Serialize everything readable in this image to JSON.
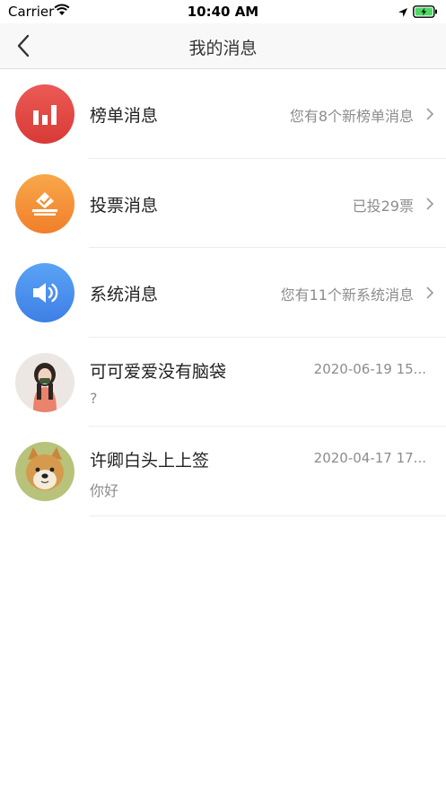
{
  "status": {
    "carrier": "Carrier",
    "time": "10:40 AM"
  },
  "nav": {
    "title": "我的消息"
  },
  "system_items": [
    {
      "title": "榜单消息",
      "detail": "您有8个新榜单消息",
      "icon": "bar-chart-icon",
      "color": "#e0453f"
    },
    {
      "title": "投票消息",
      "detail": "已投29票",
      "icon": "ballot-box-icon",
      "color": "#f3902f"
    },
    {
      "title": "系统消息",
      "detail": "您有11个新系统消息",
      "icon": "speaker-icon",
      "color": "#4a8ded"
    }
  ],
  "chats": [
    {
      "name": "可可爱爱没有脑袋",
      "preview": "?",
      "time": "2020-06-19 15...",
      "avatar": "girl-avatar"
    },
    {
      "name": "许卿白头上上签",
      "preview": "你好",
      "time": "2020-04-17 17...",
      "avatar": "shiba-dog-avatar"
    }
  ]
}
